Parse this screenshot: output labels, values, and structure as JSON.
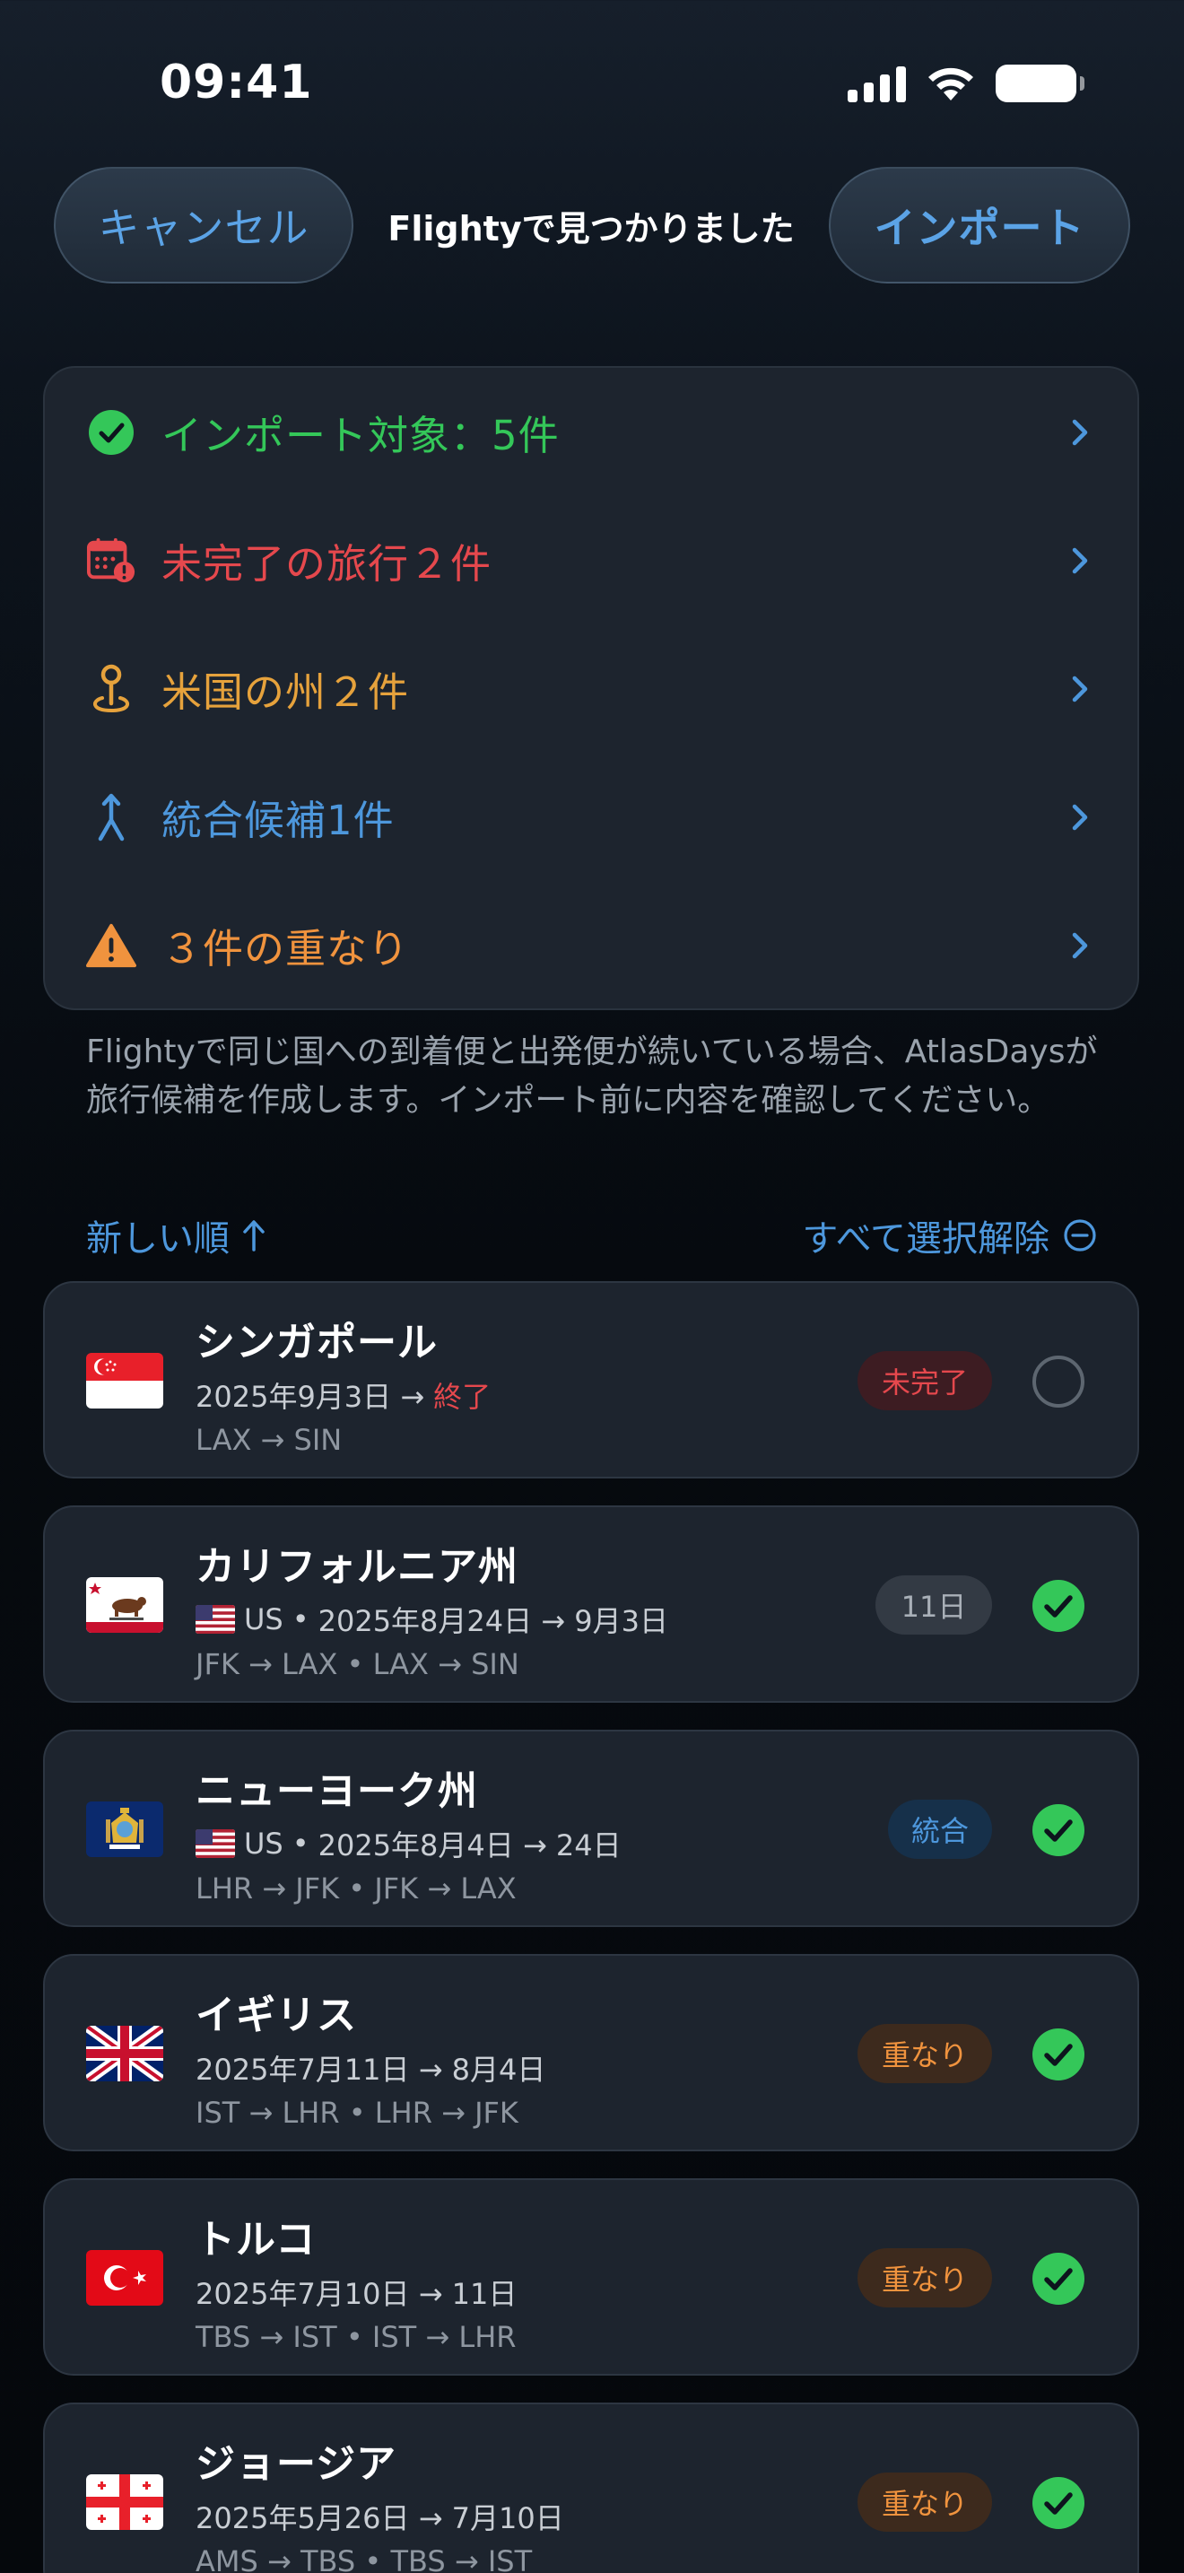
{
  "status_bar": {
    "time": "09:41"
  },
  "nav": {
    "cancel_label": "キャンセル",
    "title": "Flightyで見つかりました",
    "import_label": "インポート"
  },
  "summary": {
    "items": [
      {
        "label": "インポート対象：5件",
        "color": "#34c759",
        "icon": "check-circle-icon"
      },
      {
        "label": "未完了の旅行２件",
        "color": "#e5484d",
        "icon": "calendar-alert-icon"
      },
      {
        "label": "米国の州２件",
        "color": "#e6a23c",
        "icon": "map-pin-icon"
      },
      {
        "label": "統合候補1件",
        "color": "#4d97dc",
        "icon": "merge-icon"
      },
      {
        "label": "３件の重なり",
        "color": "#f0933e",
        "icon": "warning-icon"
      }
    ],
    "note": "Flightyで同じ国への到着便と出発便が続いている場合、AtlasDaysが旅行候補を作成します。インポート前に内容を確認してください。"
  },
  "list": {
    "sort_label": "新しい順",
    "deselect_label": "すべて選択解除",
    "trips": [
      {
        "name": "シンガポール",
        "flag": "sg",
        "country_code": "",
        "dates": "2025年9月3日 → ",
        "end_text": "終了",
        "routes": "LAX → SIN",
        "badge": "未完了",
        "badge_type": "incomplete",
        "selected": false
      },
      {
        "name": "カリフォルニア州",
        "flag": "ca",
        "country_code": "US",
        "dates": "2025年8月24日 → 9月3日",
        "end_text": "",
        "routes": "JFK → LAX • LAX → SIN",
        "badge": "11日",
        "badge_type": "days",
        "selected": true
      },
      {
        "name": "ニューヨーク州",
        "flag": "ny",
        "country_code": "US",
        "dates": "2025年8月4日 → 24日",
        "end_text": "",
        "routes": "LHR → JFK • JFK → LAX",
        "badge": "統合",
        "badge_type": "merge",
        "selected": true
      },
      {
        "name": "イギリス",
        "flag": "gb",
        "country_code": "",
        "dates": "2025年7月11日 → 8月4日",
        "end_text": "",
        "routes": "IST → LHR • LHR → JFK",
        "badge": "重なり",
        "badge_type": "overlap",
        "selected": true
      },
      {
        "name": "トルコ",
        "flag": "tr",
        "country_code": "",
        "dates": "2025年7月10日 → 11日",
        "end_text": "",
        "routes": "TBS → IST • IST → LHR",
        "badge": "重なり",
        "badge_type": "overlap",
        "selected": true
      },
      {
        "name": "ジョージア",
        "flag": "ge",
        "country_code": "",
        "dates": "2025年5月26日 → 7月10日",
        "end_text": "",
        "routes": "AMS → TBS • TBS → IST",
        "badge": "重なり",
        "badge_type": "overlap",
        "selected": true
      }
    ]
  },
  "colors": {
    "accent": "#4d97dc",
    "check": "#34c759",
    "card": "#1d242e"
  }
}
